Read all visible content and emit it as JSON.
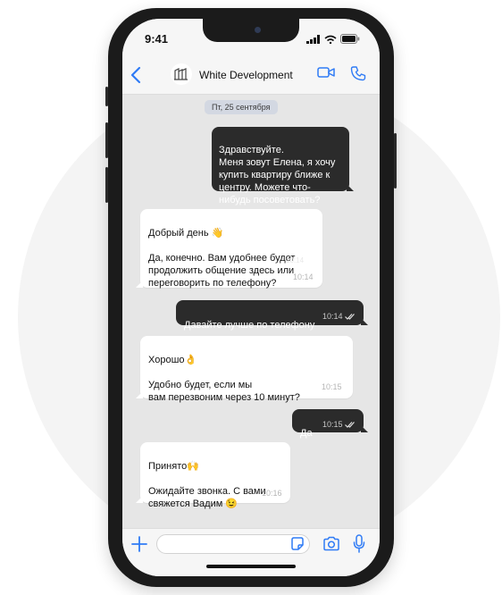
{
  "status_bar": {
    "time": "9:41"
  },
  "header": {
    "contact_name": "White Development"
  },
  "chat": {
    "date": "Пт, 25 сентября",
    "messages": [
      {
        "direction": "out",
        "text": "Здравствуйте.\nМеня зовут Елена, я хочу купить квартиру ближе к центру. Можете что-нибудь посоветовать?",
        "time": ""
      },
      {
        "direction": "in",
        "text": "Добрый день 👋\n\nДа, конечно. Вам удобнее будет продолжить общение здесь или переговорить по телефону?",
        "time": "10:14",
        "ghost_time": "10:14"
      },
      {
        "direction": "out",
        "text": "Давайте лучше по телефону",
        "time": "10:14"
      },
      {
        "direction": "in",
        "text": "Хорошо👌\n\nУдобно будет, если мы\nвам перезвоним через 10 минут?",
        "time": "10:15"
      },
      {
        "direction": "out",
        "text": "Да",
        "time": "10:15"
      },
      {
        "direction": "in",
        "text": "Принято🙌\n\nОжидайте звонка. С вами\nсвяжется Вадим 😉",
        "time": "10:16"
      }
    ]
  },
  "composer": {
    "value": "",
    "placeholder": ""
  },
  "colors": {
    "accent": "#2f7bf5",
    "outgoing_bubble": "#2b2b2b",
    "incoming_bubble": "#ffffff",
    "chat_background": "#e6e6e6"
  },
  "icons": [
    "back-chevron-icon",
    "building-logo-icon",
    "video-call-icon",
    "phone-call-icon",
    "plus-icon",
    "sticker-icon",
    "camera-icon",
    "microphone-icon",
    "double-check-icon"
  ]
}
